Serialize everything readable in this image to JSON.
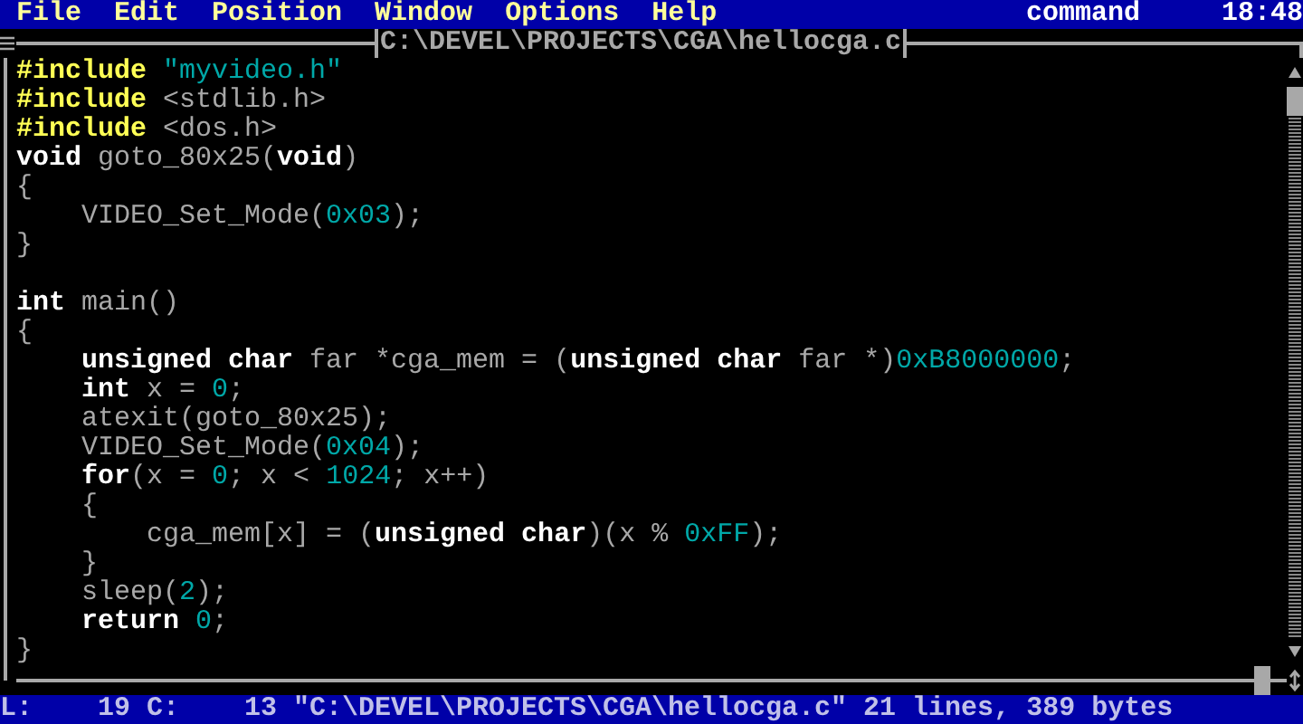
{
  "menu_bar": {
    "items": [
      {
        "label": "File"
      },
      {
        "label": "Edit"
      },
      {
        "label": "Position"
      },
      {
        "label": "Window"
      },
      {
        "label": "Options"
      },
      {
        "label": "Help"
      }
    ],
    "mode": "command",
    "clock": "18:48"
  },
  "window": {
    "title": "C:\\DEVEL\\PROJECTS\\CGA\\hellocga.c"
  },
  "code_lines": [
    {
      "segments": [
        {
          "kind": "directive",
          "text": "#include"
        },
        {
          "kind": "string",
          "text": " \"myvideo.h\""
        }
      ]
    },
    {
      "segments": [
        {
          "kind": "directive",
          "text": "#include"
        },
        {
          "kind": "plain",
          "text": " <stdlib.h>"
        }
      ]
    },
    {
      "segments": [
        {
          "kind": "directive",
          "text": "#include"
        },
        {
          "kind": "plain",
          "text": " <dos.h>"
        }
      ]
    },
    {
      "segments": [
        {
          "kind": "keyword",
          "text": "void"
        },
        {
          "kind": "plain",
          "text": " goto_80x25("
        },
        {
          "kind": "keyword",
          "text": "void"
        },
        {
          "kind": "plain",
          "text": ")"
        }
      ]
    },
    {
      "segments": [
        {
          "kind": "plain",
          "text": "{"
        }
      ]
    },
    {
      "segments": [
        {
          "kind": "plain",
          "text": "    VIDEO_Set_Mode("
        },
        {
          "kind": "number",
          "text": "0x03"
        },
        {
          "kind": "plain",
          "text": ");"
        }
      ]
    },
    {
      "segments": [
        {
          "kind": "plain",
          "text": "}"
        }
      ]
    },
    {
      "kind": "blank"
    },
    {
      "kind": "code",
      "segments": [
        {
          "kind": "keyword",
          "text": "int"
        },
        {
          "kind": "plain",
          "text": " main()"
        }
      ]
    },
    {
      "segments": [
        {
          "kind": "plain",
          "text": "{"
        }
      ]
    },
    {
      "segments": [
        {
          "kind": "keyword",
          "text": "    unsigned char"
        },
        {
          "kind": "plain",
          "text": " far *cga_mem = ("
        },
        {
          "kind": "keyword",
          "text": "unsigned char"
        },
        {
          "kind": "plain",
          "text": " far *)"
        },
        {
          "kind": "number",
          "text": "0xB8000000"
        },
        {
          "kind": "plain",
          "text": ";"
        }
      ]
    },
    {
      "segments": [
        {
          "kind": "keyword",
          "text": "    int"
        },
        {
          "kind": "plain",
          "text": " x = "
        },
        {
          "kind": "number",
          "text": "0"
        },
        {
          "kind": "plain",
          "text": ";"
        }
      ]
    },
    {
      "segments": [
        {
          "kind": "plain",
          "text": "    atexit(goto_80x25);"
        }
      ]
    },
    {
      "segments": [
        {
          "kind": "plain",
          "text": "    VIDEO_Set_Mode("
        },
        {
          "kind": "number",
          "text": "0x04"
        },
        {
          "kind": "plain",
          "text": ");"
        }
      ]
    },
    {
      "segments": [
        {
          "kind": "keyword",
          "text": "    for"
        },
        {
          "kind": "plain",
          "text": "(x = "
        },
        {
          "kind": "number",
          "text": "0"
        },
        {
          "kind": "plain",
          "text": "; x < "
        },
        {
          "kind": "number",
          "text": "1024"
        },
        {
          "kind": "plain",
          "text": "; x++)"
        }
      ]
    },
    {
      "segments": [
        {
          "kind": "plain",
          "text": "    {"
        }
      ]
    },
    {
      "segments": [
        {
          "kind": "plain",
          "text": "        cga_mem[x] = ("
        },
        {
          "kind": "keyword",
          "text": "unsigned char"
        },
        {
          "kind": "plain",
          "text": ")(x % "
        },
        {
          "kind": "number",
          "text": "0xFF"
        },
        {
          "kind": "plain",
          "text": ");"
        }
      ]
    },
    {
      "segments": [
        {
          "kind": "plain",
          "text": "    }"
        }
      ]
    },
    {
      "segments": [
        {
          "kind": "plain",
          "text": "    sleep("
        },
        {
          "kind": "number",
          "text": "2"
        },
        {
          "kind": "plain",
          "text": ");"
        }
      ]
    },
    {
      "segments": [
        {
          "kind": "keyword",
          "text": "    return"
        },
        {
          "kind": "number",
          "text": " 0"
        },
        {
          "kind": "plain",
          "text": ";"
        }
      ]
    },
    {
      "segments": [
        {
          "kind": "plain",
          "text": "}"
        }
      ]
    }
  ],
  "status_bar": {
    "line_label": "L:",
    "line": "19",
    "col_label": "C:",
    "col": "13",
    "message": "\"C:\\DEVEL\\PROJECTS\\CGA\\hellocga.c\" 21 lines, 389 bytes"
  }
}
